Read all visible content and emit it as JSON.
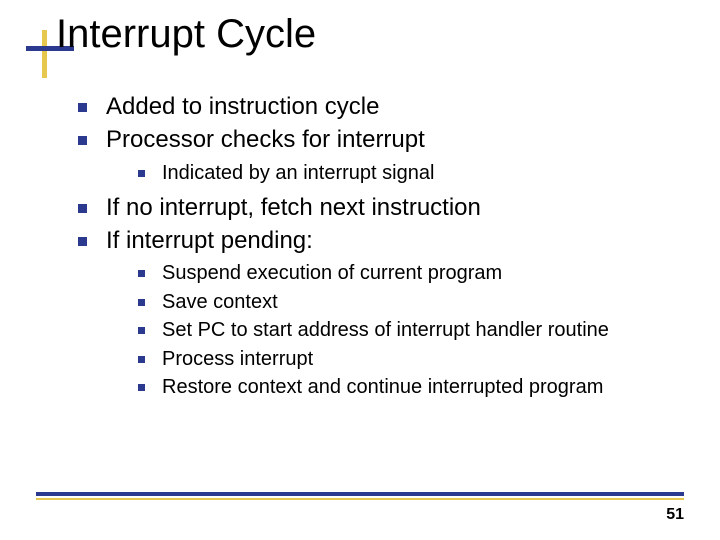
{
  "title": "Interrupt Cycle",
  "bullets": {
    "b0": "Added to instruction cycle",
    "b1": "Processor checks for interrupt",
    "b1_0": "Indicated by an interrupt signal",
    "b2": "If no interrupt, fetch next instruction",
    "b3": "If interrupt pending:",
    "b3_0": "Suspend execution of current program",
    "b3_1": "Save context",
    "b3_2": "Set PC to start address of interrupt handler routine",
    "b3_3": "Process interrupt",
    "b3_4": "Restore context and continue interrupted program"
  },
  "page_number": "51"
}
